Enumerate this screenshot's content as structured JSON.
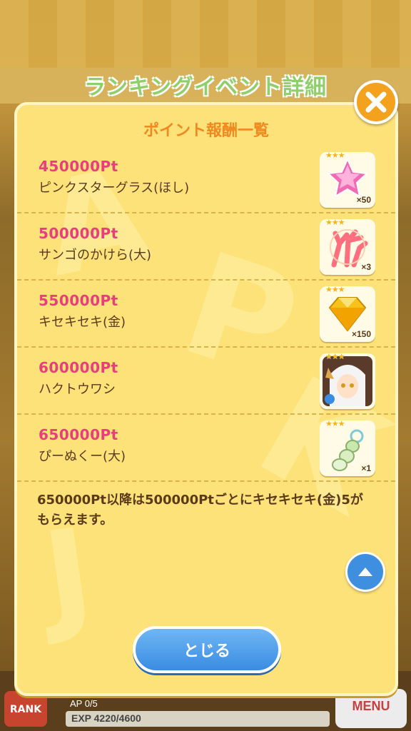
{
  "background": {
    "title": "ランキングイベント詳細",
    "rank_label": "RANK",
    "ap_text": "AP 0/5",
    "exp_text": "EXP 4220/4600",
    "menu_label": "MENU"
  },
  "dialog": {
    "title": "ポイント報酬一覧",
    "rewards": [
      {
        "points": "450000Pt",
        "name": "ピンクスターグラス(ほし)",
        "count": "×50",
        "stars": "★★★",
        "icon": "pink-star-glass-icon"
      },
      {
        "points": "500000Pt",
        "name": "サンゴのかけら(大)",
        "count": "×3",
        "stars": "★★★",
        "icon": "coral-fragment-icon"
      },
      {
        "points": "550000Pt",
        "name": "キセキセキ(金)",
        "count": "×150",
        "stars": "★★★",
        "icon": "gold-gem-icon"
      },
      {
        "points": "600000Pt",
        "name": "ハクトウワシ",
        "count": "",
        "stars": "★★★",
        "icon": "bald-eagle-friend-icon"
      },
      {
        "points": "650000Pt",
        "name": "ぴーぬくー(大)",
        "count": "×1",
        "stars": "★★★",
        "icon": "pinukuu-icon"
      }
    ],
    "note": "650000Pt以降は500000Ptごとにキセキセキ(金)5がもらえます。",
    "close_button_label": "とじる"
  },
  "colors": {
    "dialog_bg": "#fde27a",
    "title": "#f08a20",
    "points": "#e83e7c",
    "text": "#5b3a1a",
    "button": "#3a8ce2",
    "close_x": "#f4a11d"
  }
}
